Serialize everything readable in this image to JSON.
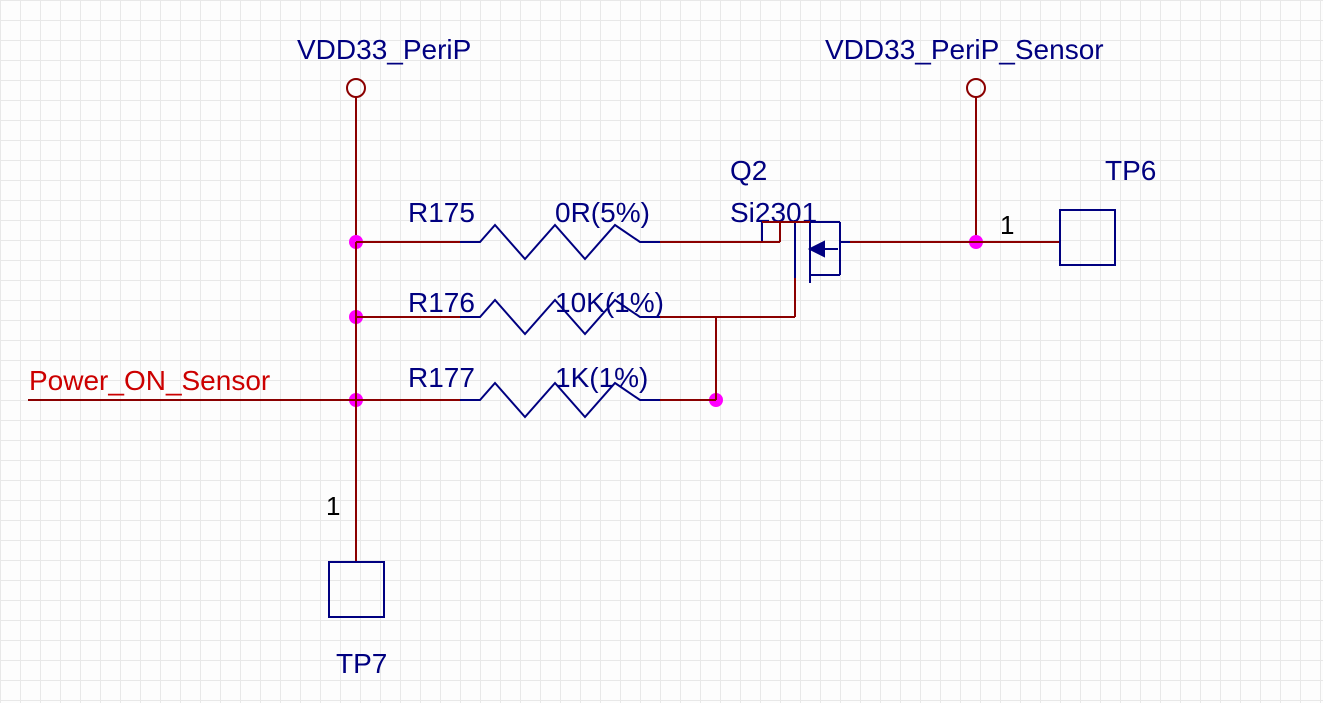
{
  "nets": {
    "vdd33_perip": "VDD33_PeriP",
    "vdd33_perip_sensor": "VDD33_PeriP_Sensor",
    "power_on_sensor": "Power_ON_Sensor"
  },
  "components": {
    "r175": {
      "ref": "R175",
      "value": "0R(5%)"
    },
    "r176": {
      "ref": "R176",
      "value": "10K(1%)"
    },
    "r177": {
      "ref": "R177",
      "value": "1K(1%)"
    },
    "q2": {
      "ref": "Q2",
      "value": "Si2301"
    },
    "tp6": {
      "ref": "TP6",
      "pin": "1"
    },
    "tp7": {
      "ref": "TP7",
      "pin": "1"
    }
  }
}
